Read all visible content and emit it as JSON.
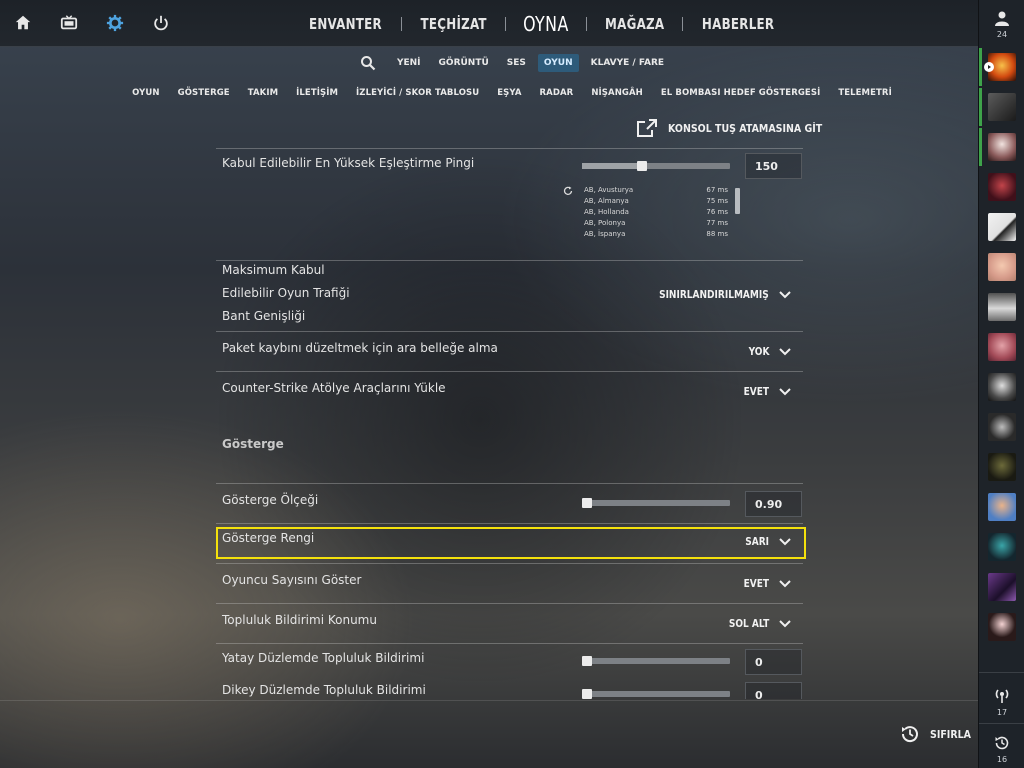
{
  "topnav": {
    "items": [
      "ENVANTER",
      "TEÇHİZAT",
      "OYNA",
      "MAĞAZA",
      "HABERLER"
    ],
    "active": "OYNA"
  },
  "left_icons": [
    "home-icon",
    "tv-icon",
    "gear-icon",
    "power-icon"
  ],
  "accent_color": "#4ea3e0",
  "rail": {
    "friends_count": "24",
    "bottom_buttons": [
      {
        "icon": "broadcast-icon",
        "count": "17"
      },
      {
        "icon": "history-icon",
        "count": "16"
      }
    ]
  },
  "subtabs": {
    "items": [
      "YENİ",
      "GÖRÜNTÜ",
      "SES",
      "OYUN",
      "KLAVYE / FARE"
    ],
    "active": "OYUN"
  },
  "categories": [
    "OYUN",
    "GÖSTERGE",
    "TAKIM",
    "İLETİŞİM",
    "İZLEYİCİ / SKOR TABLOSU",
    "EŞYA",
    "RADAR",
    "NİŞANGÂH",
    "EL BOMBASI HEDEF GÖSTERGESİ",
    "TELEMETRİ"
  ],
  "console_link": "KONSOL TUŞ ATAMASINA GİT",
  "settings": {
    "max_ping": {
      "label": "Kabul Edilebilir En Yüksek Eşleştirme Pingi",
      "value": "150",
      "slider": 0.4,
      "servers": [
        {
          "name": "AB, Avusturya",
          "ms": "67 ms"
        },
        {
          "name": "AB, Almanya",
          "ms": "75 ms"
        },
        {
          "name": "AB, Hollanda",
          "ms": "76 ms"
        },
        {
          "name": "AB, Polonya",
          "ms": "77 ms"
        },
        {
          "name": "AB, İspanya",
          "ms": "88 ms"
        }
      ]
    },
    "bandwidth": {
      "label_lines": [
        "Maksimum Kabul",
        "Edilebilir Oyun Trafiği",
        "Bant Genişliği"
      ],
      "value": "SINIRLANDIRILMAMIŞ"
    },
    "packet_loss": {
      "label": "Paket kaybını düzeltmek için ara belleğe alma",
      "value": "YOK"
    },
    "workshop": {
      "label": "Counter-Strike Atölye Araçlarını Yükle",
      "value": "EVET"
    },
    "hud_section": "Gösterge",
    "hud_scale": {
      "label": "Gösterge Ölçeği",
      "value": "0.90",
      "slider": 0.0
    },
    "hud_color": {
      "label": "Gösterge Rengi",
      "value": "SARI"
    },
    "show_players": {
      "label": "Oyuncu Sayısını Göster",
      "value": "EVET"
    },
    "notif_pos": {
      "label": "Topluluk Bildirimi Konumu",
      "value": "SOL ALT"
    },
    "notif_h": {
      "label": "Yatay Düzlemde Topluluk Bildirimi",
      "value": "0",
      "slider": 0.0
    },
    "notif_v": {
      "label": "Dikey Düzlemde Topluluk Bildirimi",
      "value": "0",
      "slider": 0.0
    }
  },
  "reset_label": "SIFIRLA"
}
